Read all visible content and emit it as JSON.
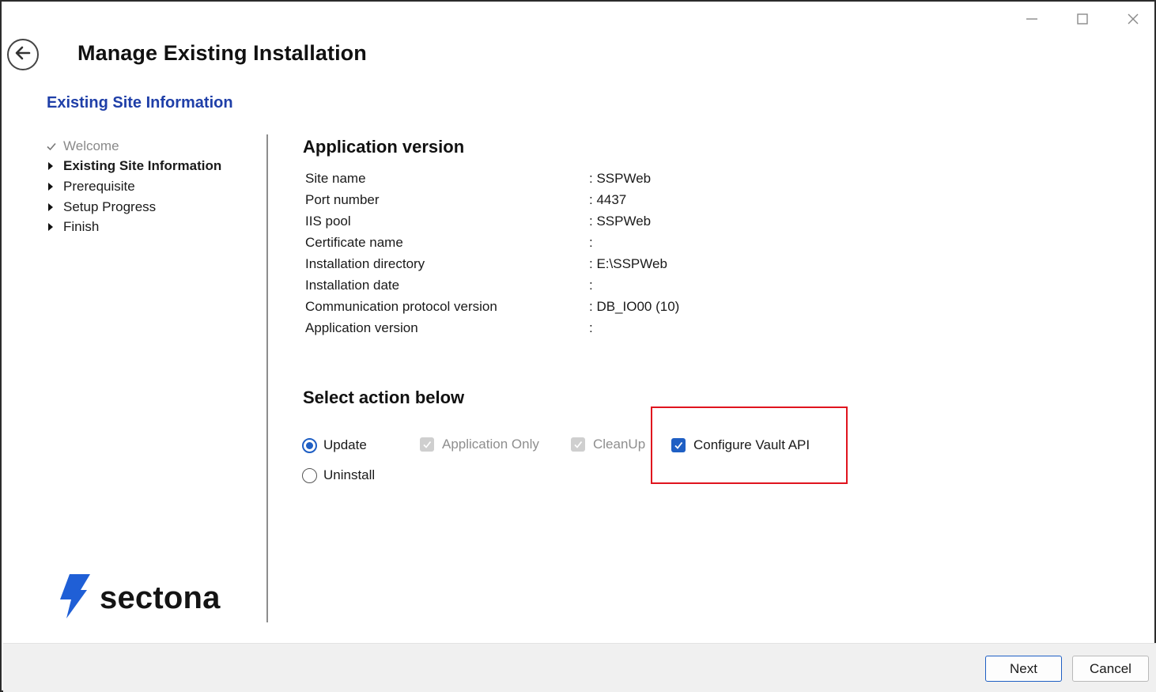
{
  "window": {
    "title": "Manage Existing Installation",
    "controls": {
      "minimize_icon": "minimize-icon",
      "maximize_icon": "maximize-icon",
      "close_icon": "close-icon"
    }
  },
  "header": {
    "back_icon": "back-arrow-icon",
    "step_title": "Existing Site Information"
  },
  "sidebar": {
    "steps": [
      {
        "label": "Welcome",
        "state": "done",
        "icon": "checkmark-icon"
      },
      {
        "label": "Existing Site Information",
        "state": "active",
        "icon": "triangle-right-icon"
      },
      {
        "label": "Prerequisite",
        "state": "pending",
        "icon": "triangle-right-icon"
      },
      {
        "label": "Setup Progress",
        "state": "pending",
        "icon": "triangle-right-icon"
      },
      {
        "label": "Finish",
        "state": "pending",
        "icon": "triangle-right-icon"
      }
    ],
    "logo_text": "sectona",
    "logo_color": "#1f5fd6"
  },
  "main": {
    "app_version_title": "Application version",
    "info_rows": [
      {
        "label": "Site name",
        "value": ": SSPWeb"
      },
      {
        "label": "Port number",
        "value": ": 4437"
      },
      {
        "label": "IIS pool",
        "value": ": SSPWeb"
      },
      {
        "label": "Certificate name",
        "value": ":"
      },
      {
        "label": "Installation directory",
        "value": ": E:\\SSPWeb"
      },
      {
        "label": "Installation date",
        "value": ":"
      },
      {
        "label": "Communication protocol version",
        "value": ": DB_IO00 (10)"
      },
      {
        "label": "Application version",
        "value": ":"
      }
    ],
    "action_title": "Select action below",
    "actions": {
      "update": {
        "label": "Update",
        "selected": true
      },
      "uninstall": {
        "label": "Uninstall",
        "selected": false
      },
      "application_only": {
        "label": "Application Only",
        "checked": true,
        "enabled": false
      },
      "cleanup": {
        "label": "CleanUp",
        "checked": true,
        "enabled": false
      },
      "configure_vault_api": {
        "label": "Configure Vault API",
        "checked": true,
        "enabled": true
      }
    },
    "accent_color": "#1f5fc4",
    "highlight_color": "#e0141e"
  },
  "footer": {
    "next_label": "Next",
    "cancel_label": "Cancel"
  }
}
